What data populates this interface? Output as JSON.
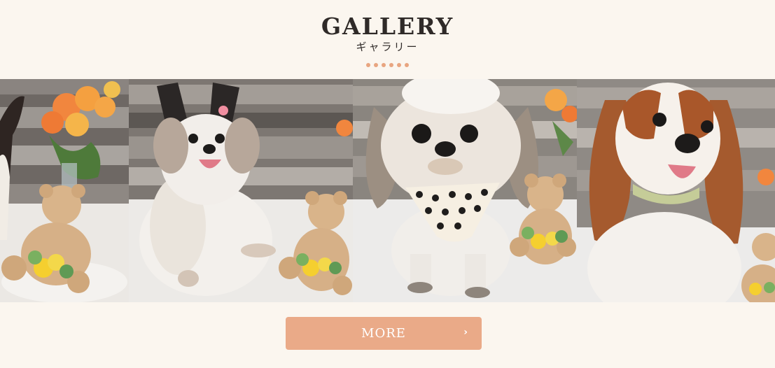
{
  "header": {
    "title": "GALLERY",
    "subtitle": "ギャラリー"
  },
  "divider": {
    "dot_count": 6,
    "color": "#e8a580"
  },
  "gallery": {
    "photos": [
      {
        "subject": "chihuahua with orange carnations and teddy bear"
      },
      {
        "subject": "papillon puppy with teddy bear"
      },
      {
        "subject": "shih tzu wearing polka dot bandana"
      },
      {
        "subject": "cavalier king charles spaniel"
      }
    ]
  },
  "more_button": {
    "label": "MORE",
    "arrow": "›",
    "color": "#eaaa88"
  },
  "colors": {
    "background": "#fbf6ef",
    "accent": "#eaaa88",
    "title_text": "#2f2a28"
  },
  "icons": {
    "more_arrow": "chevron-right-icon"
  }
}
